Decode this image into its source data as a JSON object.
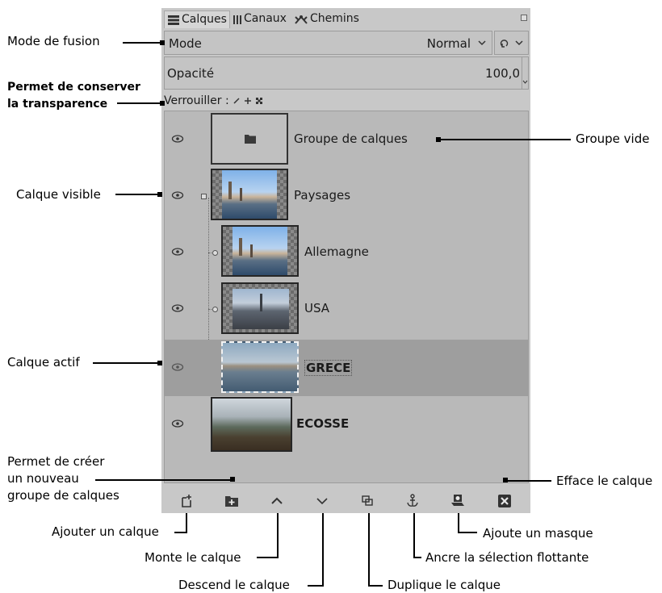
{
  "annotations": {
    "blend_mode": "Mode de fusion",
    "preserve_transparency_line1": "Permet de conserver",
    "preserve_transparency_line2": "la transparence",
    "visible_layer": "Calque visible",
    "active_layer": "Calque actif",
    "empty_group": "Groupe vide",
    "new_group_line1": "Permet de créer",
    "new_group_line2": "un nouveau",
    "new_group_line3": "groupe de calques",
    "delete_layer": "Efface le calque",
    "add_layer": "Ajouter un calque",
    "raise_layer": "Monte le calque",
    "lower_layer": "Descend le calque",
    "duplicate_layer": "Duplique le calque",
    "anchor_selection": "Ancre la sélection flottante",
    "add_mask": "Ajoute un masque"
  },
  "tabs": [
    {
      "label": "Calques",
      "icon": "layers-icon"
    },
    {
      "label": "Canaux",
      "icon": "channels-icon"
    },
    {
      "label": "Chemins",
      "icon": "paths-icon"
    }
  ],
  "mode": {
    "label": "Mode",
    "value": "Normal"
  },
  "opacity": {
    "label": "Opacité",
    "value": "100,0"
  },
  "lock": {
    "label": "Verrouiller :"
  },
  "layers": [
    {
      "name": "Groupe de calques",
      "visible": true,
      "type": "group"
    },
    {
      "name": "Paysages",
      "visible": true,
      "type": "group"
    },
    {
      "name": "Allemagne",
      "visible": true,
      "type": "layer"
    },
    {
      "name": "USA",
      "visible": true,
      "type": "layer"
    },
    {
      "name": "GRECE",
      "visible": true,
      "type": "layer",
      "active": true
    },
    {
      "name": "ECOSSE",
      "visible": true,
      "type": "layer"
    }
  ],
  "colors": {
    "panel_bg": "#c8c8c8",
    "list_bg": "#b9b9b9",
    "active_row": "#9e9e9e"
  }
}
